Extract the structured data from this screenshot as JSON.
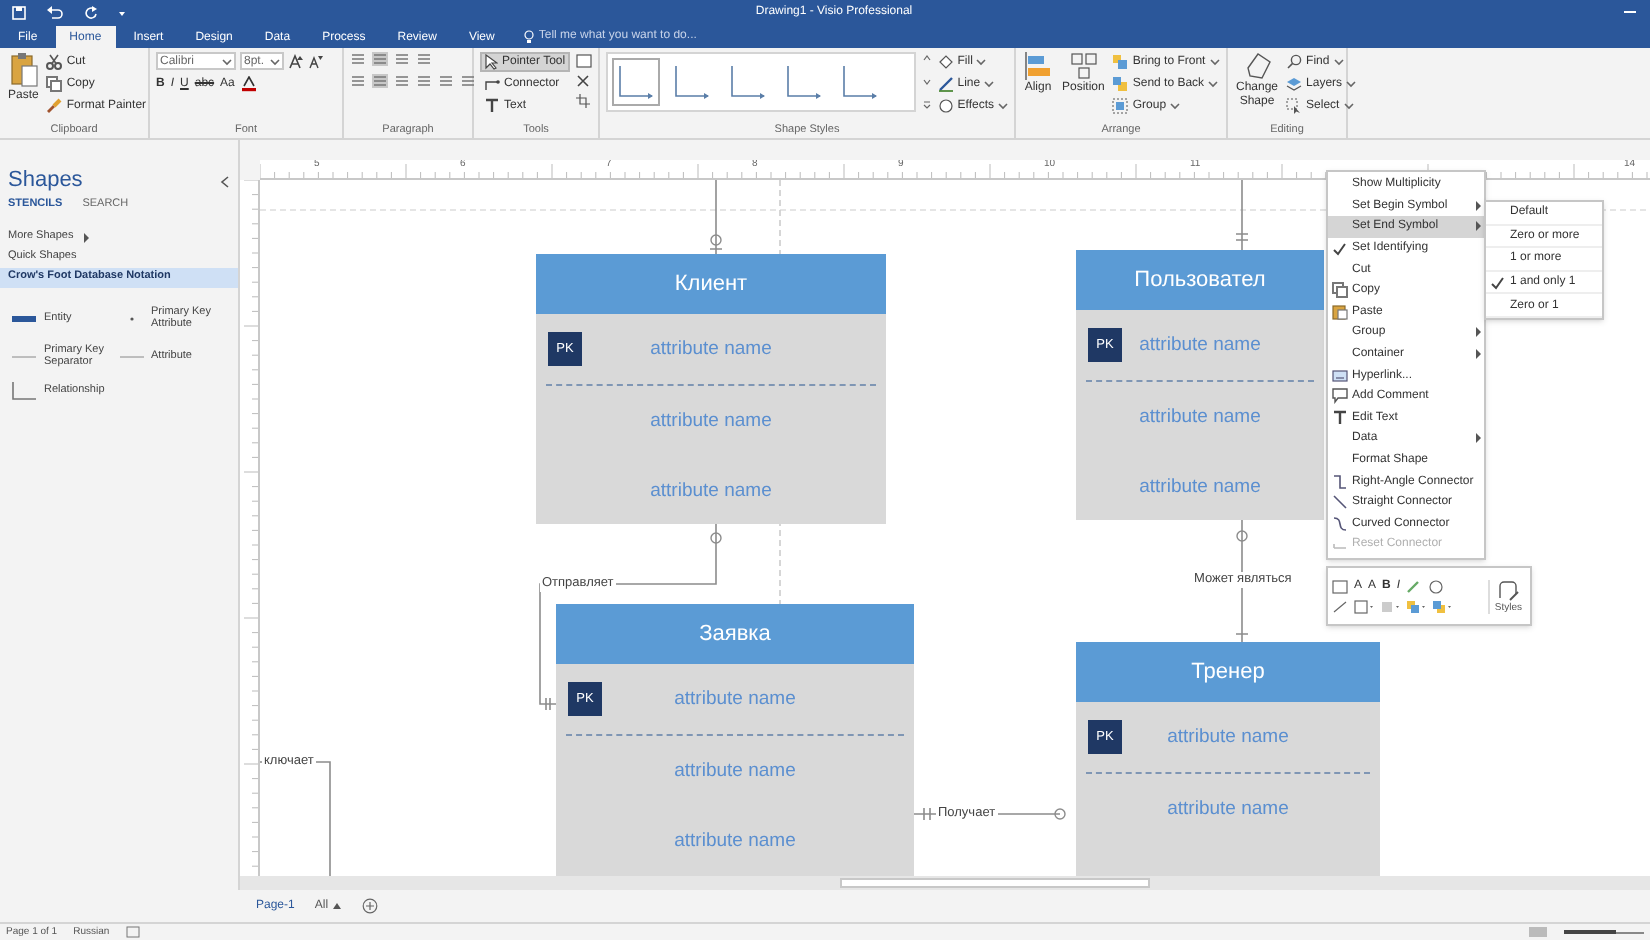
{
  "window": {
    "title": "Drawing1 - Visio Professional"
  },
  "tabs": [
    {
      "label": "File",
      "selected": false
    },
    {
      "label": "Home",
      "selected": true
    },
    {
      "label": "Insert",
      "selected": false
    },
    {
      "label": "Design",
      "selected": false
    },
    {
      "label": "Data",
      "selected": false
    },
    {
      "label": "Process",
      "selected": false
    },
    {
      "label": "Review",
      "selected": false
    },
    {
      "label": "View",
      "selected": false
    }
  ],
  "tell_me": {
    "placeholder": "Tell me what you want to do..."
  },
  "ribbon": [
    {
      "kind": "clipboard",
      "label": "Clipboard",
      "big": "Paste",
      "items": [
        "Cut",
        "Copy",
        "Format Painter"
      ]
    },
    {
      "kind": "font",
      "label": "Font",
      "font_name": "Calibri",
      "font_size": "8pt.",
      "styles": [
        "B",
        "I",
        "U",
        "abc",
        "Aa"
      ]
    },
    {
      "kind": "paragraph",
      "label": "Paragraph"
    },
    {
      "kind": "tools",
      "label": "Tools",
      "items": [
        {
          "label": "Pointer Tool",
          "selected": true
        },
        {
          "label": "Connector",
          "selected": false
        },
        {
          "label": "Text",
          "selected": false
        }
      ]
    },
    {
      "kind": "styles",
      "label": "Shape Styles",
      "items": [
        "Fill",
        "Line",
        "Effects"
      ]
    },
    {
      "kind": "arrange",
      "label": "Arrange",
      "big": [
        "Align",
        "Position"
      ],
      "items": [
        "Bring to Front",
        "Send to Back",
        "Group"
      ]
    },
    {
      "kind": "editing",
      "label": "Editing",
      "big": "Change Shape",
      "items": [
        "Find",
        "Layers",
        "Select"
      ]
    }
  ],
  "shapes_panel": {
    "title": "Shapes",
    "tabs": [
      {
        "label": "STENCILS",
        "selected": true
      },
      {
        "label": "SEARCH",
        "selected": false
      }
    ],
    "nav": [
      {
        "label": "More Shapes",
        "selected": false,
        "submenu": true
      },
      {
        "label": "Quick Shapes",
        "selected": false,
        "submenu": false
      },
      {
        "label": "Crow's Foot Database Notation",
        "selected": true,
        "submenu": false
      }
    ],
    "masters": [
      {
        "label": "Entity",
        "kind": "entity"
      },
      {
        "label": "Primary Key Attribute",
        "kind": "pk_attribute"
      },
      {
        "label": "Primary Key Separator",
        "kind": "separator"
      },
      {
        "label": "Attribute",
        "kind": "attribute"
      },
      {
        "label": "Relationship",
        "kind": "relationship"
      }
    ]
  },
  "ruler": {
    "labels": [
      "5",
      "6",
      "7",
      "8",
      "9",
      "10",
      "11",
      "14"
    ]
  },
  "entities": [
    {
      "title": "Клиент",
      "attributes": [
        {
          "name": "attribute name",
          "key": "PK"
        },
        {
          "name": "attribute name"
        },
        {
          "name": "attribute name"
        }
      ]
    },
    {
      "title": "Пользовател",
      "attributes": [
        {
          "name": "attribute name",
          "key": "PK"
        },
        {
          "name": "attribute name"
        },
        {
          "name": "attribute name"
        }
      ]
    },
    {
      "title": "Заявка",
      "attributes": [
        {
          "name": "attribute name",
          "key": "PK"
        },
        {
          "name": "attribute name"
        },
        {
          "name": "attribute name"
        }
      ]
    },
    {
      "title": "Тренер",
      "attributes": [
        {
          "name": "attribute name",
          "key": "PK"
        },
        {
          "name": "attribute name"
        }
      ]
    }
  ],
  "relationships": [
    {
      "label": "Отправляет"
    },
    {
      "label": "Может являться"
    },
    {
      "label": "Получает"
    },
    {
      "label": "ключает"
    }
  ],
  "context_menu": [
    {
      "label": "Show Multiplicity",
      "kind": "plain",
      "selected": false,
      "disabled": false,
      "checked": false,
      "submenu": false
    },
    {
      "label": "Set Begin Symbol",
      "kind": "plain",
      "selected": false,
      "disabled": false,
      "checked": false,
      "submenu": true
    },
    {
      "label": "Set End Symbol",
      "kind": "plain",
      "selected": true,
      "disabled": false,
      "checked": false,
      "submenu": true
    },
    {
      "label": "Set Identifying",
      "kind": "plain",
      "selected": false,
      "disabled": false,
      "checked": true,
      "submenu": false
    },
    {
      "label": "Cut",
      "kind": "cut",
      "selected": false,
      "disabled": false,
      "checked": false,
      "submenu": false
    },
    {
      "label": "Copy",
      "kind": "copy",
      "selected": false,
      "disabled": false,
      "checked": false,
      "submenu": false
    },
    {
      "label": "Paste",
      "kind": "paste",
      "selected": false,
      "disabled": false,
      "checked": false,
      "submenu": false
    },
    {
      "label": "Group",
      "kind": "plain",
      "selected": false,
      "disabled": false,
      "checked": false,
      "submenu": true
    },
    {
      "label": "Container",
      "kind": "plain",
      "selected": false,
      "disabled": false,
      "checked": false,
      "submenu": true
    },
    {
      "label": "Hyperlink...",
      "kind": "link",
      "selected": false,
      "disabled": false,
      "checked": false,
      "submenu": false
    },
    {
      "label": "Add Comment",
      "kind": "comment",
      "selected": false,
      "disabled": false,
      "checked": false,
      "submenu": false
    },
    {
      "label": "Edit Text",
      "kind": "text",
      "selected": false,
      "disabled": false,
      "checked": false,
      "submenu": false
    },
    {
      "label": "Data",
      "kind": "plain",
      "selected": false,
      "disabled": false,
      "checked": false,
      "submenu": true
    },
    {
      "label": "Format Shape",
      "kind": "plain",
      "selected": false,
      "disabled": false,
      "checked": false,
      "submenu": false
    },
    {
      "label": "Right-Angle Connector",
      "kind": "right_angle",
      "selected": false,
      "disabled": false,
      "checked": false,
      "submenu": false
    },
    {
      "label": "Straight Connector",
      "kind": "straight",
      "selected": false,
      "disabled": false,
      "checked": false,
      "submenu": false
    },
    {
      "label": "Curved Connector",
      "kind": "curved",
      "selected": false,
      "disabled": false,
      "checked": false,
      "submenu": false
    },
    {
      "label": "Reset Connector",
      "kind": "reset",
      "selected": false,
      "disabled": true,
      "checked": false,
      "submenu": false
    }
  ],
  "submenu": [
    {
      "label": "Default",
      "checked": false
    },
    {
      "label": "Zero or more",
      "checked": false
    },
    {
      "label": "1 or more",
      "checked": false
    },
    {
      "label": "1 and only 1",
      "checked": true
    },
    {
      "label": "Zero or 1",
      "checked": false
    }
  ],
  "mini_toolbar": {
    "glyphs": [
      "A",
      "A",
      "B",
      "I"
    ],
    "styles_label": "Styles"
  },
  "page_tabs": [
    {
      "label": "Page-1",
      "selected": true
    },
    {
      "label": "All",
      "selected": false
    }
  ],
  "status_bar": {
    "texts": [
      "Page 1 of 1",
      "Russian"
    ],
    "zoom": {
      "level": 0.65
    }
  }
}
